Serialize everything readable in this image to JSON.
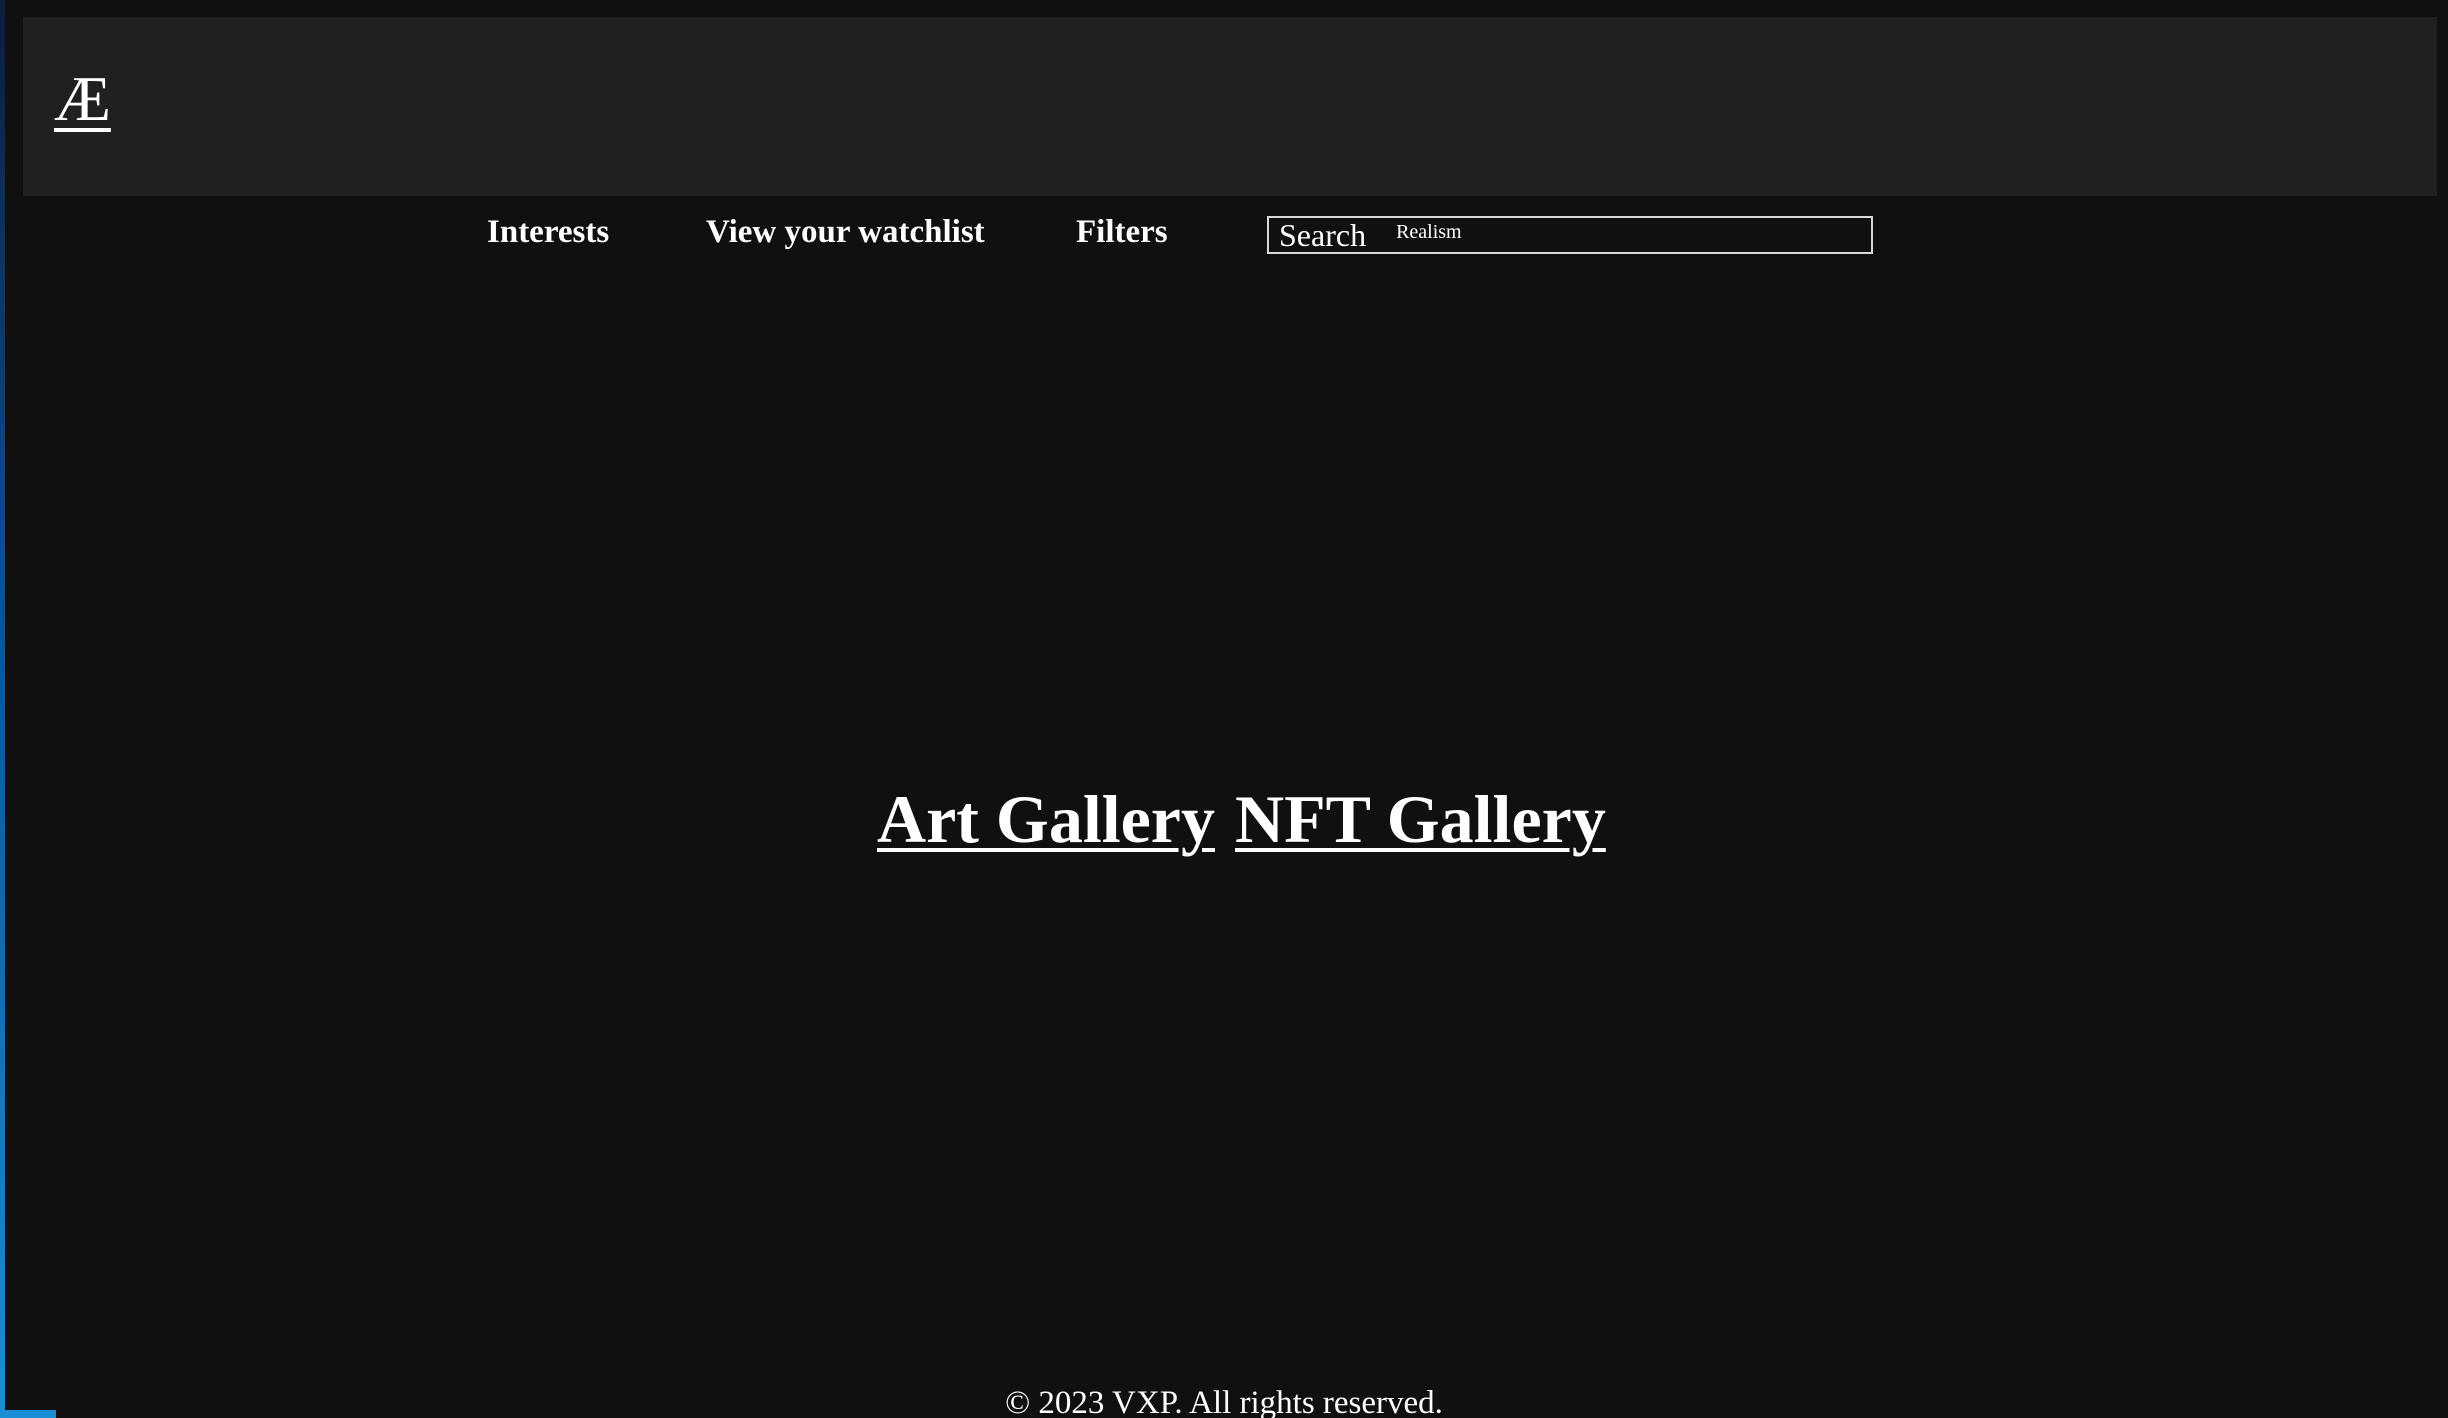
{
  "header": {
    "logo_text": "Æ"
  },
  "nav": {
    "interests_label": "Interests",
    "watchlist_label": "View your watchlist",
    "filters_label": "Filters",
    "search_label": "Search",
    "search_value": "Realism"
  },
  "main": {
    "art_gallery_label": "Art Gallery",
    "nft_gallery_label": "NFT Gallery"
  },
  "footer": {
    "copyright": "© 2023 VXP. All rights reserved."
  },
  "colors": {
    "background": "#101010",
    "header_background": "#202020",
    "text": "#ffffff",
    "accent": "#1a8fd6"
  }
}
